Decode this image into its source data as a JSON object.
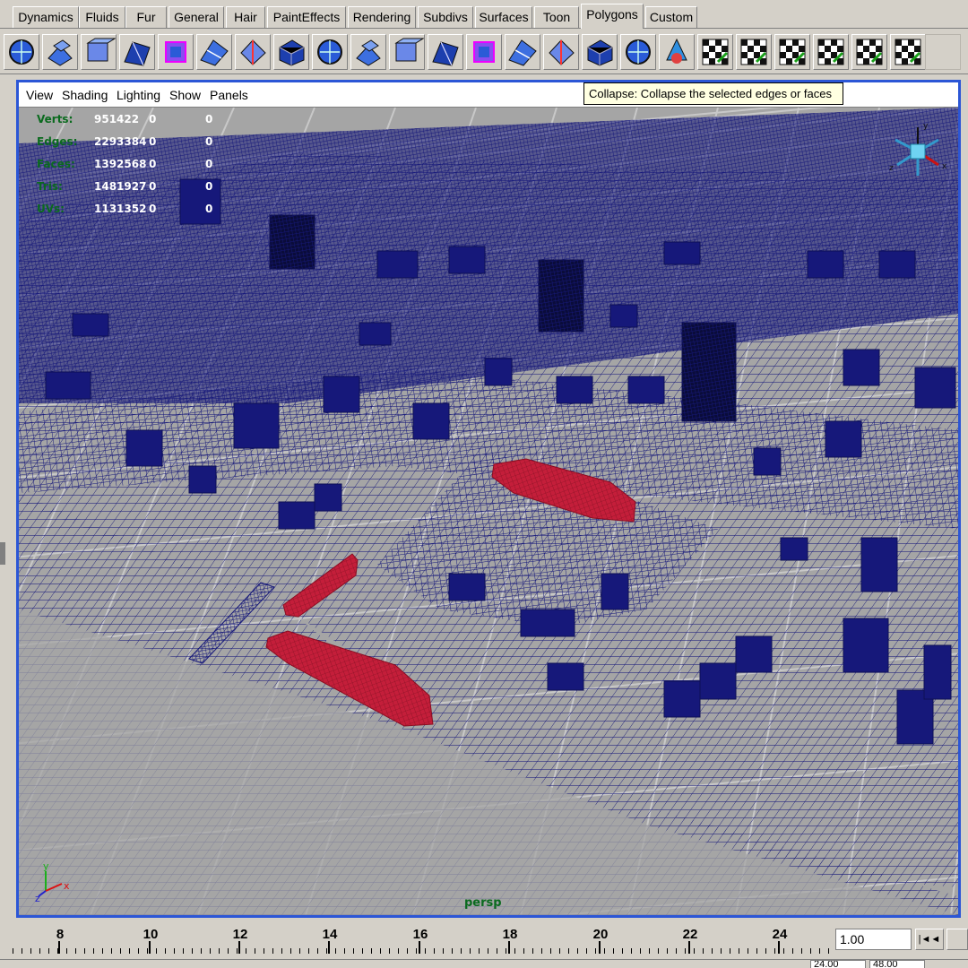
{
  "shelf_tabs": [
    {
      "label": "Dynamics",
      "active": false
    },
    {
      "label": "Fluids",
      "active": false
    },
    {
      "label": "Fur",
      "active": false
    },
    {
      "label": "General",
      "active": false
    },
    {
      "label": "Hair",
      "active": false
    },
    {
      "label": "PaintEffects",
      "active": false
    },
    {
      "label": "Rendering",
      "active": false
    },
    {
      "label": "Subdivs",
      "active": false
    },
    {
      "label": "Surfaces",
      "active": false
    },
    {
      "label": "Toon",
      "active": false
    },
    {
      "label": "Polygons",
      "active": true
    },
    {
      "label": "Custom",
      "active": false
    }
  ],
  "shelf_tools": [
    {
      "icon": "poly-globe-icon"
    },
    {
      "icon": "combine-icon"
    },
    {
      "icon": "separate-icon"
    },
    {
      "icon": "boolean-icon"
    },
    {
      "icon": "smooth-cube-icon"
    },
    {
      "icon": "plane-split-icon"
    },
    {
      "icon": "cut-faces-icon"
    },
    {
      "icon": "extrude-face-icon"
    },
    {
      "icon": "extrude-edge-icon"
    },
    {
      "icon": "bevel-icon"
    },
    {
      "icon": "chamfer-icon"
    },
    {
      "icon": "wedge-icon"
    },
    {
      "icon": "append-polygon-icon"
    },
    {
      "icon": "split-polygon-icon"
    },
    {
      "icon": "merge-vertices-icon"
    },
    {
      "icon": "collapse-icon"
    },
    {
      "icon": "subdivide-icon"
    },
    {
      "icon": "transform-component-icon"
    },
    {
      "icon": "uv-planar-icon"
    },
    {
      "icon": "uv-auto-map-icon"
    },
    {
      "icon": "uv-cylindrical-icon"
    },
    {
      "icon": "uv-spherical-icon"
    },
    {
      "icon": "uv-layout-icon"
    },
    {
      "icon": "uv-editor-icon"
    },
    {
      "icon": "blank-shelf-slot-icon"
    }
  ],
  "tooltip": "Collapse: Collapse the selected edges or faces",
  "viewport_menu": [
    "View",
    "Shading",
    "Lighting",
    "Show",
    "Panels"
  ],
  "hud": [
    {
      "label": "Verts:",
      "v1": "951422",
      "v2": "0",
      "v3": "0"
    },
    {
      "label": "Edges:",
      "v1": "2293384",
      "v2": "0",
      "v3": "0"
    },
    {
      "label": "Faces:",
      "v1": "1392568",
      "v2": "0",
      "v3": "0"
    },
    {
      "label": "Tris:",
      "v1": "1481927",
      "v2": "0",
      "v3": "0"
    },
    {
      "label": "UVs:",
      "v1": "1131352",
      "v2": "0",
      "v3": "0"
    }
  ],
  "camera_label": "persp",
  "axis": {
    "y": "y",
    "z": "z",
    "x": "x"
  },
  "timeline": {
    "ticks": [
      "8",
      "10",
      "12",
      "14",
      "16",
      "18",
      "20",
      "22",
      "24"
    ],
    "current_frame": "1.00",
    "range_start": "24.00",
    "range_end": "48.00"
  },
  "colors": {
    "wire": "#16187a",
    "selected": "#c41e3a",
    "background": "#a5a5a5",
    "hud_label": "#0a6a1e",
    "viewport_border": "#2b56d6"
  }
}
